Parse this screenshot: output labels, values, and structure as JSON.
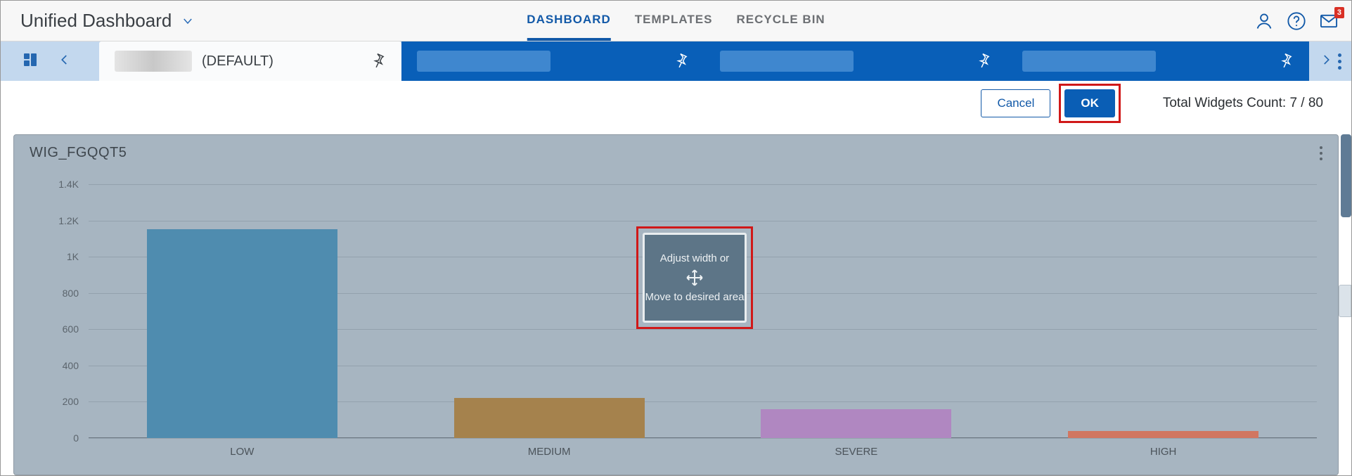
{
  "header": {
    "title": "Unified Dashboard",
    "nav": [
      "DASHBOARD",
      "TEMPLATES",
      "RECYCLE BIN"
    ],
    "active_nav_index": 0,
    "mail_badge": "3"
  },
  "tabs": {
    "default_label": "(DEFAULT)"
  },
  "actions": {
    "cancel": "Cancel",
    "ok": "OK",
    "widget_count_prefix": "Total Widgets Count: ",
    "widget_count_value": "7 / 80"
  },
  "widget": {
    "title": "WIG_FGQQT5",
    "drag_line1": "Adjust width or",
    "drag_line2": "Move to desired area"
  },
  "chart_data": {
    "type": "bar",
    "title": "",
    "xlabel": "",
    "ylabel": "",
    "ylim": [
      0,
      1400
    ],
    "y_ticks": [
      "0",
      "200",
      "400",
      "600",
      "800",
      "1K",
      "1.2K",
      "1.4K"
    ],
    "categories": [
      "LOW",
      "MEDIUM",
      "SEVERE",
      "HIGH"
    ],
    "values": [
      1150,
      220,
      160,
      40
    ],
    "colors": [
      "#4f8caf",
      "#a5824d",
      "#b087c1",
      "#d17661"
    ]
  }
}
